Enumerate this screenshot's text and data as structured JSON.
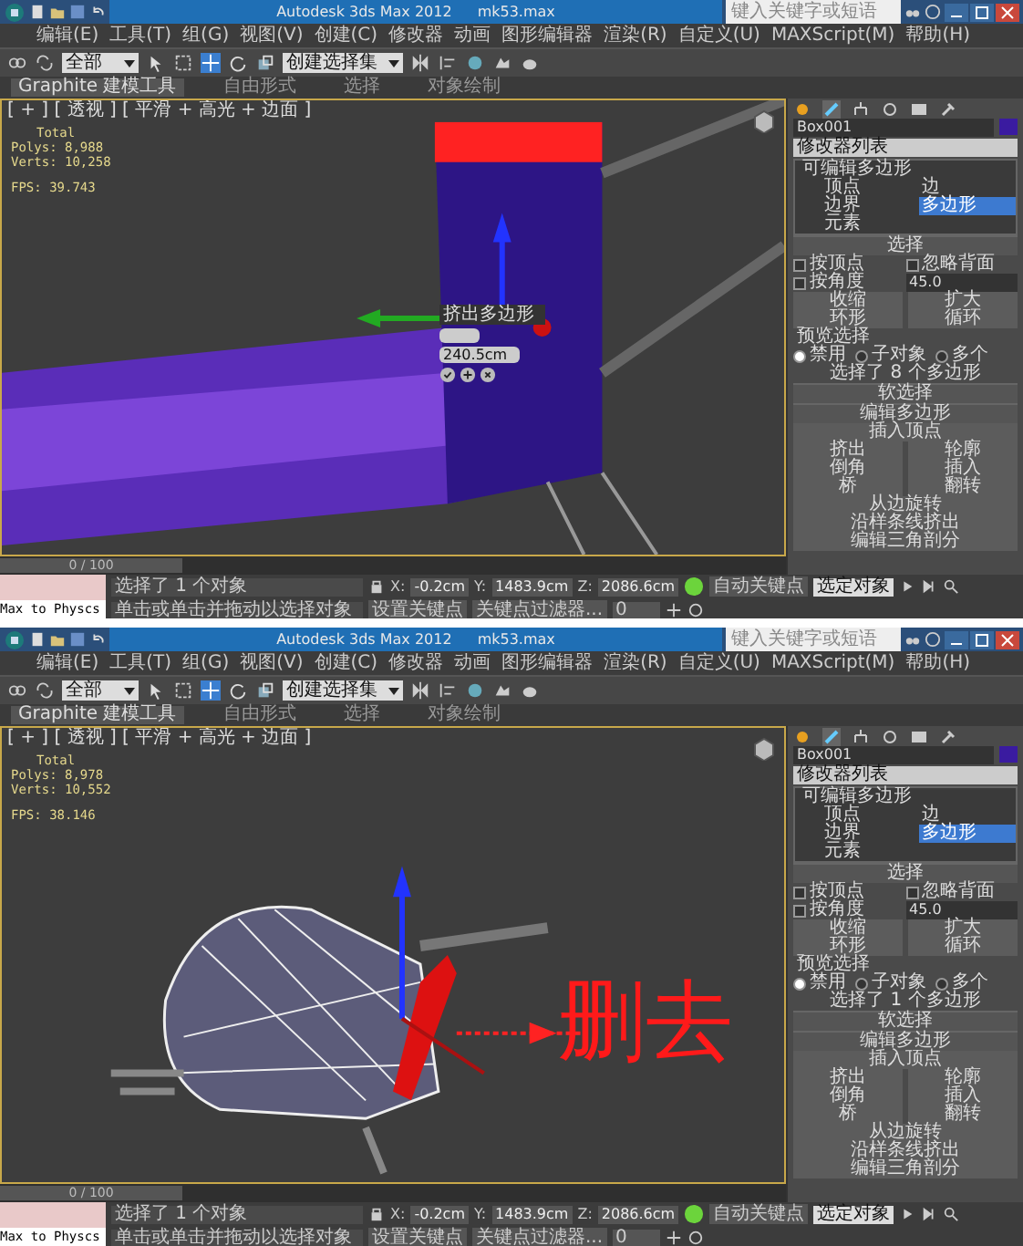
{
  "screens": [
    {
      "title": {
        "app": "Autodesk 3ds Max 2012",
        "file": "mk53.max"
      },
      "search": {
        "placeholder": "键入关键字或短语"
      },
      "menu": [
        "编辑(E)",
        "工具(T)",
        "组(G)",
        "视图(V)",
        "创建(C)",
        "修改器",
        "动画",
        "图形编辑器",
        "渲染(R)",
        "自定义(U)",
        "MAXScript(M)",
        "帮助(H)"
      ],
      "toolbar": {
        "filter": "全部",
        "selection_set": "创建选择集"
      },
      "ribbon_tabs": [
        {
          "label": "Graphite 建模工具",
          "selected": true
        },
        {
          "label": "自由形式",
          "selected": false
        },
        {
          "label": "选择",
          "selected": false
        },
        {
          "label": "对象绘制",
          "selected": false
        }
      ],
      "viewport": {
        "label": "[ + ] [ 透视 ] [ 平滑 + 高光 + 边面 ]",
        "stats": [
          "Total",
          "Polys: 8,988",
          "Verts: 10,258",
          "FPS: 39.743"
        ],
        "scene": {
          "kind": "wing"
        },
        "caddy": {
          "title": "挤出多边形",
          "value": "240.5cm"
        }
      },
      "command_panel": {
        "object_name": "Box001",
        "modifier_list": "修改器列表",
        "stack": [
          {
            "label": "可编辑多边形",
            "selected": false,
            "children": [
              {
                "label": "顶点",
                "selected": false
              },
              {
                "label": "边",
                "selected": false
              },
              {
                "label": "边界",
                "selected": false
              },
              {
                "label": "多边形",
                "selected": true
              },
              {
                "label": "元素",
                "selected": false
              }
            ]
          }
        ],
        "selection": {
          "title": "选择",
          "checkboxes": [
            {
              "label": "按顶点",
              "checked": false
            },
            {
              "label": "忽略背面",
              "checked": false
            },
            {
              "label": "按角度",
              "checked": false
            }
          ],
          "angle": "45.0",
          "buttons": [
            [
              "收缩",
              "扩大"
            ],
            [
              "环形",
              "循环"
            ]
          ],
          "preview_label": "预览选择",
          "preview_options": [
            {
              "label": "禁用",
              "selected": true
            },
            {
              "label": "子对象",
              "selected": false
            },
            {
              "label": "多个",
              "selected": false
            }
          ],
          "info": "选择了 8 个多边形"
        },
        "rollouts": [
          "软选择",
          "编辑多边形"
        ],
        "edit_buttons": [
          [
            "插入顶点"
          ],
          [
            "挤出",
            "轮廓"
          ],
          [
            "倒角",
            "插入"
          ],
          [
            "桥",
            "翻转"
          ],
          [
            "从边旋转"
          ],
          [
            "沿样条线挤出"
          ],
          [
            "编辑三角剖分"
          ]
        ]
      },
      "timeline": {
        "frame": "0 / 100",
        "level": 0
      },
      "status": {
        "script": "Max to Physcs",
        "selection": "选择了 1 个对象",
        "prompt": "单击或单击并拖动以选择对象",
        "coords": [
          {
            "axis": "X:",
            "value": "-0.2cm"
          },
          {
            "axis": "Y:",
            "value": "1483.9cm"
          },
          {
            "axis": "Z:",
            "value": "2086.6cm"
          }
        ],
        "auto_key": "自动关键点",
        "key_mode": "选定对象",
        "set_key": "设置关键点",
        "key_filters": "关键点过滤器...",
        "frame": "0"
      }
    },
    {
      "title": {
        "app": "Autodesk 3ds Max 2012",
        "file": "mk53.max"
      },
      "search": {
        "placeholder": "键入关键字或短语"
      },
      "menu": [
        "编辑(E)",
        "工具(T)",
        "组(G)",
        "视图(V)",
        "创建(C)",
        "修改器",
        "动画",
        "图形编辑器",
        "渲染(R)",
        "自定义(U)",
        "MAXScript(M)",
        "帮助(H)"
      ],
      "toolbar": {
        "filter": "全部",
        "selection_set": "创建选择集"
      },
      "ribbon_tabs": [
        {
          "label": "Graphite 建模工具",
          "selected": true
        },
        {
          "label": "自由形式",
          "selected": false
        },
        {
          "label": "选择",
          "selected": false
        },
        {
          "label": "对象绘制",
          "selected": false
        }
      ],
      "viewport": {
        "label": "[ + ] [ 透视 ] [ 平滑 + 高光 + 边面 ]",
        "stats": [
          "Total",
          "Polys: 8,978",
          "Verts: 10,552",
          "FPS: 38.146"
        ],
        "scene": {
          "kind": "mesh"
        },
        "annotation": "删去"
      },
      "command_panel": {
        "object_name": "Box001",
        "modifier_list": "修改器列表",
        "stack": [
          {
            "label": "可编辑多边形",
            "selected": false,
            "children": [
              {
                "label": "顶点",
                "selected": false
              },
              {
                "label": "边",
                "selected": false
              },
              {
                "label": "边界",
                "selected": false
              },
              {
                "label": "多边形",
                "selected": true
              },
              {
                "label": "元素",
                "selected": false
              }
            ]
          }
        ],
        "selection": {
          "title": "选择",
          "checkboxes": [
            {
              "label": "按顶点",
              "checked": false
            },
            {
              "label": "忽略背面",
              "checked": false
            },
            {
              "label": "按角度",
              "checked": false
            }
          ],
          "angle": "45.0",
          "buttons": [
            [
              "收缩",
              "扩大"
            ],
            [
              "环形",
              "循环"
            ]
          ],
          "preview_label": "预览选择",
          "preview_options": [
            {
              "label": "禁用",
              "selected": true
            },
            {
              "label": "子对象",
              "selected": false
            },
            {
              "label": "多个",
              "selected": false
            }
          ],
          "info": "选择了 1 个多边形"
        },
        "rollouts": [
          "软选择",
          "编辑多边形"
        ],
        "edit_buttons": [
          [
            "插入顶点"
          ],
          [
            "挤出",
            "轮廓"
          ],
          [
            "倒角",
            "插入"
          ],
          [
            "桥",
            "翻转"
          ],
          [
            "从边旋转"
          ],
          [
            "沿样条线挤出"
          ],
          [
            "编辑三角剖分"
          ]
        ]
      },
      "timeline": {
        "frame": "0 / 100",
        "level": 0
      },
      "status": {
        "script": "Max to Physcs",
        "selection": "选择了 1 个对象",
        "prompt": "单击或单击并拖动以选择对象",
        "coords": [
          {
            "axis": "X:",
            "value": "-0.2cm"
          },
          {
            "axis": "Y:",
            "value": "1483.9cm"
          },
          {
            "axis": "Z:",
            "value": "2086.6cm"
          }
        ],
        "auto_key": "自动关键点",
        "key_mode": "选定对象",
        "set_key": "设置关键点",
        "key_filters": "关键点过滤器...",
        "frame": "0"
      }
    }
  ]
}
